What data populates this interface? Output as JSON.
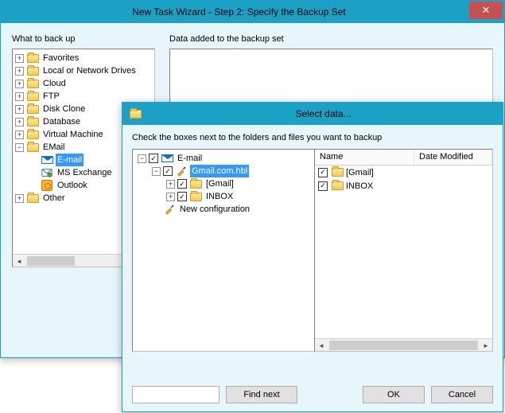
{
  "backWindow": {
    "title": "New Task Wizard - Step 2: Specify the Backup Set",
    "closeGlyph": "✕",
    "leftLabel": "What to back up",
    "rightLabel": "Data added to the backup set",
    "tree": [
      {
        "exp": "+",
        "ind": 0,
        "type": "folder",
        "label": "Favorites"
      },
      {
        "exp": "+",
        "ind": 0,
        "type": "folder",
        "label": "Local or Network Drives"
      },
      {
        "exp": "+",
        "ind": 0,
        "type": "folder",
        "label": "Cloud"
      },
      {
        "exp": "+",
        "ind": 0,
        "type": "folder",
        "label": "FTP"
      },
      {
        "exp": "+",
        "ind": 0,
        "type": "folder",
        "label": "Disk Clone"
      },
      {
        "exp": "+",
        "ind": 0,
        "type": "folder",
        "label": "Database"
      },
      {
        "exp": "+",
        "ind": 0,
        "type": "folder",
        "label": "Virtual Machine"
      },
      {
        "exp": "−",
        "ind": 0,
        "type": "folder-open",
        "label": "EMail"
      },
      {
        "exp": "",
        "ind": 1,
        "type": "mail",
        "label": "E-mail",
        "selected": true
      },
      {
        "exp": "",
        "ind": 1,
        "type": "exchange",
        "label": "MS Exchange"
      },
      {
        "exp": "",
        "ind": 1,
        "type": "outlook",
        "label": "Outlook"
      },
      {
        "exp": "+",
        "ind": 0,
        "type": "folder",
        "label": "Other"
      }
    ]
  },
  "frontWindow": {
    "title": "Select data...",
    "instruction": "Check the boxes next to the folders and files you want to backup",
    "tree": [
      {
        "exp": "−",
        "ind": 0,
        "chk": true,
        "type": "mail",
        "label": "E-mail"
      },
      {
        "exp": "−",
        "ind": 1,
        "chk": true,
        "type": "tool",
        "label": "Gmail.com.hbl",
        "selected": true
      },
      {
        "exp": "+",
        "ind": 2,
        "chk": true,
        "type": "folder",
        "label": "[Gmail]"
      },
      {
        "exp": "+",
        "ind": 2,
        "chk": true,
        "type": "folder",
        "label": "INBOX"
      },
      {
        "exp": "",
        "ind": 1,
        "chk": null,
        "type": "tool",
        "label": "New configuration"
      }
    ],
    "listHeaders": {
      "name": "Name",
      "date": "Date Modified"
    },
    "listRows": [
      {
        "chk": true,
        "type": "folder",
        "label": "[Gmail]"
      },
      {
        "chk": true,
        "type": "folder",
        "label": "INBOX"
      }
    ],
    "buttons": {
      "findNext": "Find next",
      "ok": "OK",
      "cancel": "Cancel"
    },
    "searchValue": ""
  }
}
